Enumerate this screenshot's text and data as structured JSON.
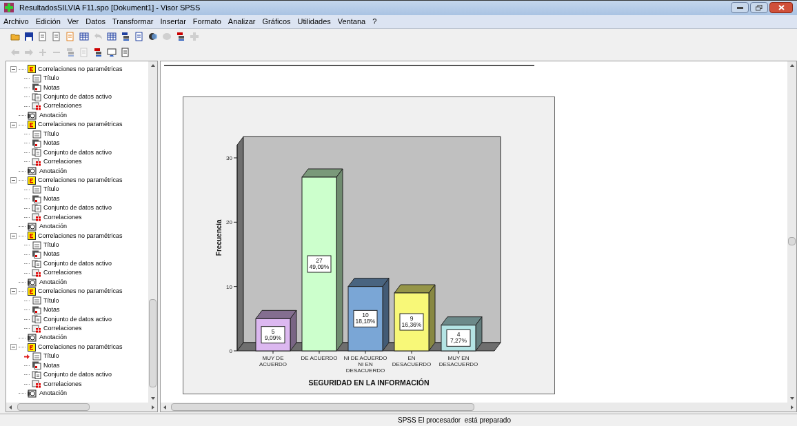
{
  "window": {
    "title": "ResultadosSILVIA F11.spo [Dokument1] - Visor SPSS"
  },
  "menu": [
    "Archivo",
    "Edición",
    "Ver",
    "Datos",
    "Transformar",
    "Insertar",
    "Formato",
    "Analizar",
    "Gráficos",
    "Utilidades",
    "Ventana",
    "?"
  ],
  "outline": [
    {
      "kind": "procedure",
      "label": "Correlaciones no paramétricas",
      "expanded": true,
      "children": [
        {
          "kind": "title",
          "label": "Título",
          "selected": false
        },
        {
          "kind": "notes",
          "label": "Notas",
          "selected": false
        },
        {
          "kind": "dataset",
          "label": "Conjunto de datos activo",
          "selected": false
        },
        {
          "kind": "table",
          "label": "Correlaciones",
          "selected": false
        }
      ]
    },
    {
      "kind": "annotation",
      "label": "Anotación"
    },
    {
      "kind": "procedure",
      "label": "Correlaciones no paramétricas",
      "expanded": true,
      "children": [
        {
          "kind": "title",
          "label": "Título",
          "selected": false
        },
        {
          "kind": "notes",
          "label": "Notas",
          "selected": false
        },
        {
          "kind": "dataset",
          "label": "Conjunto de datos activo",
          "selected": false
        },
        {
          "kind": "table",
          "label": "Correlaciones",
          "selected": false
        }
      ]
    },
    {
      "kind": "annotation",
      "label": "Anotación"
    },
    {
      "kind": "procedure",
      "label": "Correlaciones no paramétricas",
      "expanded": true,
      "children": [
        {
          "kind": "title",
          "label": "Título",
          "selected": false
        },
        {
          "kind": "notes",
          "label": "Notas",
          "selected": false
        },
        {
          "kind": "dataset",
          "label": "Conjunto de datos activo",
          "selected": false
        },
        {
          "kind": "table",
          "label": "Correlaciones",
          "selected": false
        }
      ]
    },
    {
      "kind": "annotation",
      "label": "Anotación"
    },
    {
      "kind": "procedure",
      "label": "Correlaciones no paramétricas",
      "expanded": true,
      "children": [
        {
          "kind": "title",
          "label": "Título",
          "selected": false
        },
        {
          "kind": "notes",
          "label": "Notas",
          "selected": false
        },
        {
          "kind": "dataset",
          "label": "Conjunto de datos activo",
          "selected": false
        },
        {
          "kind": "table",
          "label": "Correlaciones",
          "selected": false
        }
      ]
    },
    {
      "kind": "annotation",
      "label": "Anotación"
    },
    {
      "kind": "procedure",
      "label": "Correlaciones no paramétricas",
      "expanded": true,
      "children": [
        {
          "kind": "title",
          "label": "Título",
          "selected": false
        },
        {
          "kind": "notes",
          "label": "Notas",
          "selected": false
        },
        {
          "kind": "dataset",
          "label": "Conjunto de datos activo",
          "selected": false
        },
        {
          "kind": "table",
          "label": "Correlaciones",
          "selected": false
        }
      ]
    },
    {
      "kind": "annotation",
      "label": "Anotación"
    },
    {
      "kind": "procedure",
      "label": "Correlaciones no paramétricas",
      "expanded": true,
      "children": [
        {
          "kind": "title",
          "label": "Título",
          "selected": true
        },
        {
          "kind": "notes",
          "label": "Notas",
          "selected": false
        },
        {
          "kind": "dataset",
          "label": "Conjunto de datos activo",
          "selected": false
        },
        {
          "kind": "table",
          "label": "Correlaciones",
          "selected": false
        }
      ]
    },
    {
      "kind": "annotation",
      "label": "Anotación"
    }
  ],
  "chart": {
    "chart_data": {
      "type": "bar",
      "xlabel": "SEGURIDAD EN LA INFORMACIÓN",
      "ylabel": "Frecuencia",
      "categories": [
        "MUY DE\nACUERDO",
        "DE ACUERDO",
        "NI DE ACUERDO\nNI EN\nDESACUERDO",
        "EN\nDESACUERDO",
        "MUY EN\nDESACUERDO"
      ],
      "values": [
        5,
        27,
        10,
        9,
        4
      ],
      "colors": [
        "#dcb8f0",
        "#ccffcc",
        "#7aa6d6",
        "#f8f878",
        "#b4e4e4"
      ],
      "value_labels": [
        "5\n9,09%",
        "27\n49,09%",
        "10\n18,18%",
        "9\n16,36%",
        "4\n7,27%"
      ],
      "ylim": [
        0,
        32
      ],
      "yticks": [
        0,
        10,
        20,
        30
      ]
    }
  },
  "status_bar": {
    "message": "SPSS El procesador  está preparado"
  }
}
